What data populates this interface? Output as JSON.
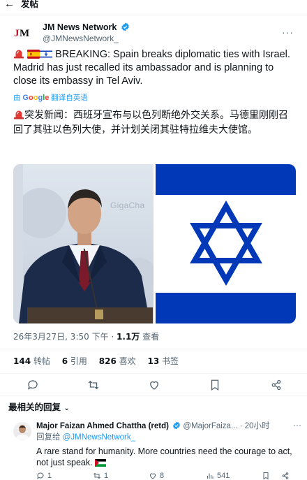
{
  "header": {
    "title": "发帖"
  },
  "tweet": {
    "author_name": "JM News Network",
    "handle": "@JMNewsNetwork_",
    "text_en": "BREAKING: Spain breaks diplomatic ties with Israel. Madrid has just recalled its ambassador and is planning to close its embassy in Tel Aviv.",
    "translate_by": "由",
    "translate_google": "Google",
    "translate_label": "翻译自英语",
    "text_zh": "突发新闻：西班牙宣布与以色列断绝外交关系。马德里刚刚召回了其驻以色列大使，并计划关闭其驻特拉维夫大使馆。",
    "image_watermark": "GigaCha",
    "date": "26年3月27日, 3:50 下午",
    "views_count": "1.1万",
    "views_label": "查看",
    "stats": {
      "retweets": "144",
      "retweets_label": "转帖",
      "quotes": "6",
      "quotes_label": "引用",
      "likes": "826",
      "likes_label": "喜欢",
      "bookmarks": "13",
      "bookmarks_label": "书签"
    }
  },
  "replies_header": "最相关的回复",
  "reply": {
    "author_name": "Major Faizan Ahmed Chattha (retd)",
    "handle": "@MajorFaiza...",
    "time": "· 20小时",
    "replying_prefix": "回复给",
    "replying_to": "@JMNewsNetwork_",
    "text": "A rare stand for humanity. More countries need the courage to act, not just speak.",
    "replies": "1",
    "retweets": "1",
    "likes": "8",
    "views": "541"
  },
  "colors": {
    "accent": "#1d9bf0",
    "israel_blue": "#0038b8",
    "text": "#0f1419",
    "muted": "#536471"
  },
  "icons": [
    "back-arrow-icon",
    "verified-badge-icon",
    "more-icon",
    "siren-icon",
    "spain-flag-icon",
    "israel-flag-icon",
    "reply-icon",
    "retweet-icon",
    "like-icon",
    "bookmark-icon",
    "share-icon",
    "views-icon",
    "palestine-flag-icon"
  ]
}
